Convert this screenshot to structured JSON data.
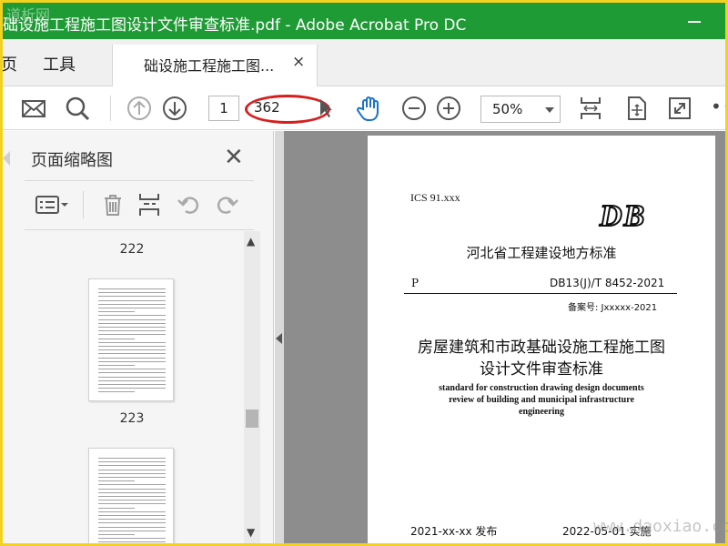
{
  "window": {
    "title": "础设施工程施工图设计文件审查标准.pdf - Adobe Acrobat Pro DC",
    "watermark_top": "道析网"
  },
  "tabs": {
    "home_fragment": "页",
    "tools": "工具",
    "doc_tab": "础设施工程施工图...",
    "close_glyph": "×"
  },
  "toolbar": {
    "page_current": "1",
    "page_total": "362",
    "zoom": "50%",
    "more": "•••",
    "icons": [
      "mail-icon",
      "search-icon",
      "arrow-up-icon",
      "arrow-down-icon",
      "hand-icon",
      "zoom-out-icon",
      "zoom-in-icon",
      "fit-page-icon",
      "rotate-page-icon",
      "fullscreen-icon"
    ]
  },
  "panel": {
    "title": "页面缩略图",
    "close_glyph": "✕",
    "thumbs": [
      {
        "label": "222"
      },
      {
        "label": "223"
      }
    ]
  },
  "document": {
    "ics": "ICS 91.xxx",
    "db": "DB",
    "issuer": "河北省工程建设地方标准",
    "p": "P",
    "code": "DB13(J)/T 8452-2021",
    "filing": "备案号: Jxxxxx-2021",
    "title_line1": "房屋建筑和市政基础设施工程施工图",
    "title_line2": "设计文件审查标准",
    "en_line1": "standard for construction drawing design documents",
    "en_line2": "review of building and municipal infrastructure",
    "en_line3": "engineering",
    "issue_date": "2021-xx-xx  发布",
    "impl_date": "2022-05-01  实施"
  },
  "watermark_bottom": "www.daoxiao.com",
  "colors": {
    "frame": "#f2d21f",
    "titlebar": "#1f9b36",
    "annotation_oval": "#d62020",
    "hand_tool": "#1a73c8"
  }
}
